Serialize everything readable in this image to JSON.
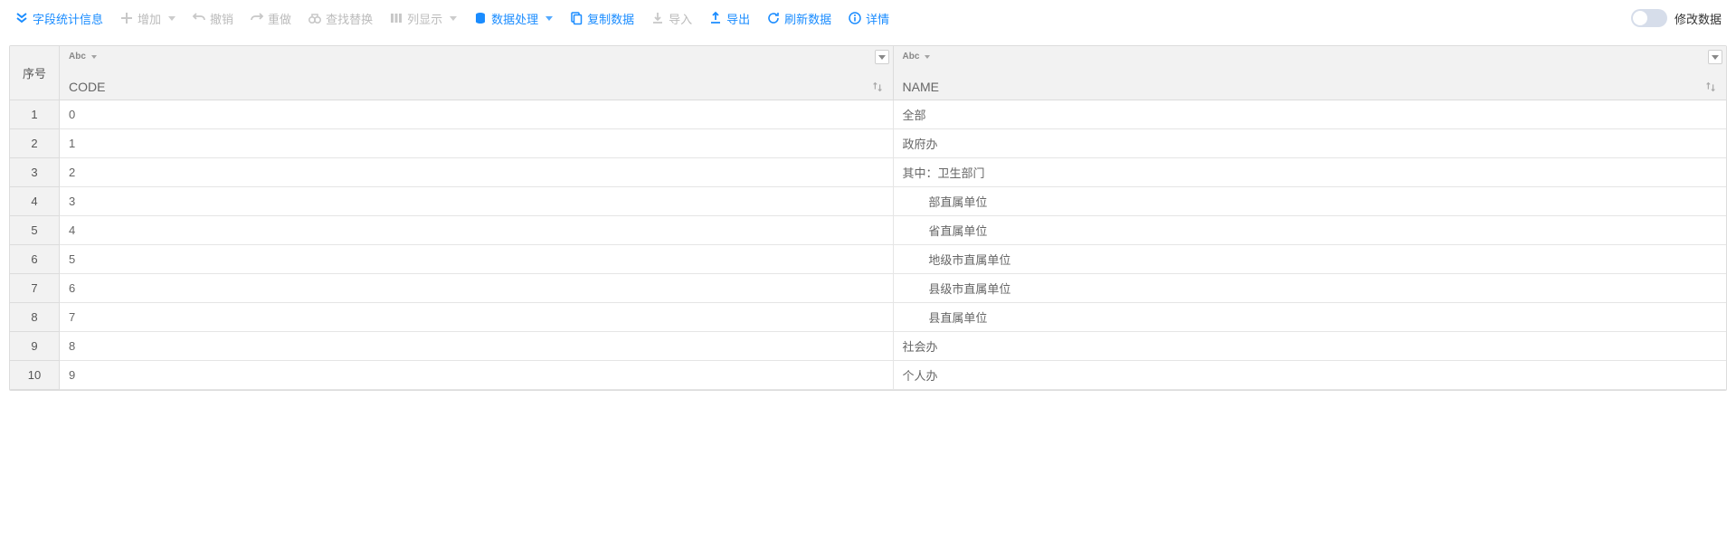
{
  "toolbar": {
    "field_stats": "字段统计信息",
    "add": "增加",
    "undo": "撤销",
    "redo": "重做",
    "find_replace": "查找替换",
    "column_display": "列显示",
    "data_process": "数据处理",
    "copy_data": "复制数据",
    "import": "导入",
    "export": "导出",
    "refresh": "刷新数据",
    "detail": "详情",
    "edit_toggle_label": "修改数据"
  },
  "columns": {
    "seq_header": "序号",
    "type_label": "Abc",
    "col0": {
      "name": "CODE"
    },
    "col1": {
      "name": "NAME"
    }
  },
  "rows": [
    {
      "seq": "1",
      "code": "0",
      "name": "全部"
    },
    {
      "seq": "2",
      "code": "1",
      "name": "政府办"
    },
    {
      "seq": "3",
      "code": "2",
      "name": "其中：卫生部门"
    },
    {
      "seq": "4",
      "code": "3",
      "name": "        部直属单位"
    },
    {
      "seq": "5",
      "code": "4",
      "name": "        省直属单位"
    },
    {
      "seq": "6",
      "code": "5",
      "name": "        地级市直属单位"
    },
    {
      "seq": "7",
      "code": "6",
      "name": "        县级市直属单位"
    },
    {
      "seq": "8",
      "code": "7",
      "name": "        县直属单位"
    },
    {
      "seq": "9",
      "code": "8",
      "name": "社会办"
    },
    {
      "seq": "10",
      "code": "9",
      "name": "个人办"
    }
  ]
}
